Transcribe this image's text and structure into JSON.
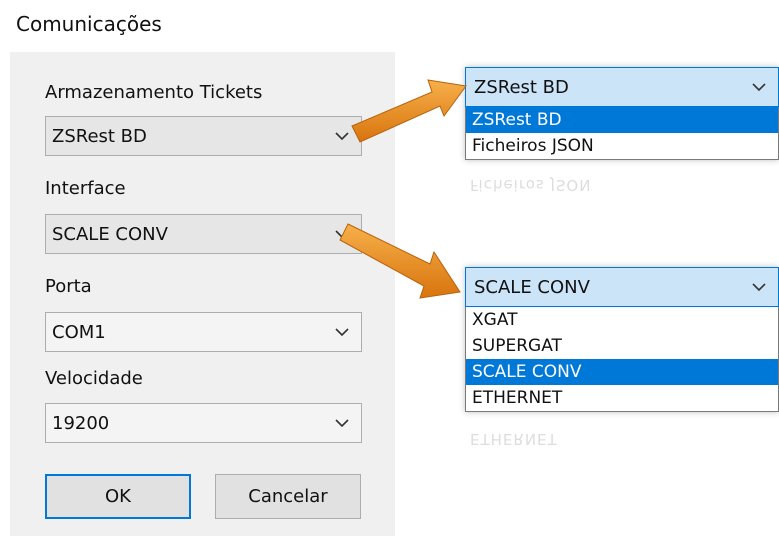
{
  "window": {
    "title": "Comunicações"
  },
  "form": {
    "storage": {
      "label": "Armazenamento Tickets",
      "value": "ZSRest BD"
    },
    "interface": {
      "label": "Interface",
      "value": "SCALE CONV"
    },
    "port": {
      "label": "Porta",
      "value": "COM1"
    },
    "speed": {
      "label": "Velocidade",
      "value": "19200"
    },
    "buttons": {
      "ok": "OK",
      "cancel": "Cancelar"
    }
  },
  "storage_dropdown": {
    "selected": "ZSRest BD",
    "options": [
      "ZSRest BD",
      "Ficheiros JSON"
    ],
    "reflection": "Ficheiros JSON"
  },
  "interface_dropdown": {
    "selected": "SCALE CONV",
    "options": [
      "XGAT",
      "SUPERGAT",
      "SCALE CONV",
      "ETHERNET"
    ],
    "reflection": "ETHERNET"
  },
  "colors": {
    "arrow_orange": "#f0901e",
    "highlight_blue": "#0078d7",
    "head_blue": "#cce4f7"
  },
  "icons": {
    "dropdown": "chevron-down-icon",
    "annotation": "arrow-icon"
  }
}
